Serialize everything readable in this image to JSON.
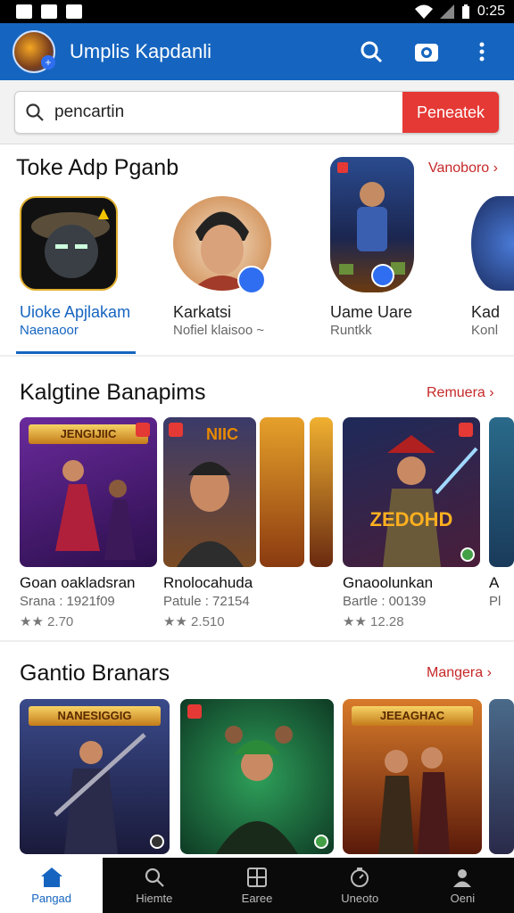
{
  "status_bar": {
    "time": "0:25"
  },
  "app_bar": {
    "title": "Umplis Kapdanli"
  },
  "search": {
    "value": "pencartin",
    "button_label": "Peneatek"
  },
  "section1": {
    "title": "Toke Adp Pganb",
    "see_all": "Vanoboro ›",
    "items": [
      {
        "name": "Uioke Apjlakam",
        "sub": "Naenaoor"
      },
      {
        "name": "Karkatsi",
        "sub": "Nofiel klaisoo ~"
      },
      {
        "name": "Uame Uare",
        "sub": "Runtkk"
      },
      {
        "name": "Kad",
        "sub": "Konl"
      }
    ]
  },
  "section2": {
    "title": "Kalgtine Banapims",
    "see_all": "Remuera ›",
    "cards": [
      {
        "title": "Goan oakladsran",
        "meta": "Srana : 1921f09",
        "rating": "★★ 2.70",
        "banner": "JENGIJIIC"
      },
      {
        "title": "Rnolocahuda",
        "meta": "Patule : 72154",
        "rating": "★★ 2.510",
        "banner": "NIIC"
      },
      {
        "title": "Gnaoolunkan",
        "meta": "Bartle : 00139",
        "rating": "★★ 12.28",
        "banner": "ZEDOHD"
      },
      {
        "title": "A",
        "meta": "Pl",
        "rating": "",
        "banner": ""
      }
    ]
  },
  "section3": {
    "title": "Gantio Branars",
    "see_all": "Mangera ›",
    "cards": [
      {
        "banner": "NANESIGGIG"
      },
      {
        "banner": ""
      },
      {
        "banner": "JEEAGHAC"
      }
    ]
  },
  "bottom_nav": [
    {
      "label": "Pangad",
      "icon": "home-icon"
    },
    {
      "label": "Hiemte",
      "icon": "search-icon"
    },
    {
      "label": "Earee",
      "icon": "grid-icon"
    },
    {
      "label": "Uneoto",
      "icon": "timer-icon"
    },
    {
      "label": "Oeni",
      "icon": "profile-icon"
    }
  ],
  "colors": {
    "primary": "#1565c0",
    "accent": "#e53935",
    "link": "#c62828"
  }
}
